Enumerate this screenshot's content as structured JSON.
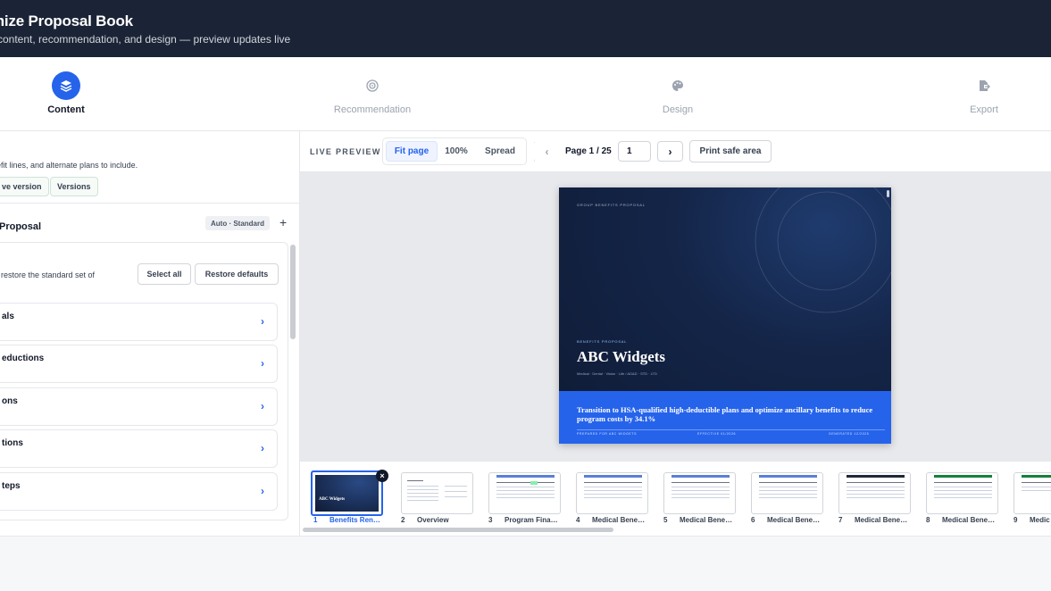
{
  "header": {
    "title": "mize Proposal Book",
    "subtitle": "content, recommendation, and design — preview updates live"
  },
  "stepper": {
    "steps": [
      {
        "label": "Content",
        "icon": "layers-icon",
        "active": true
      },
      {
        "label": "Recommendation",
        "icon": "target-icon",
        "active": false
      },
      {
        "label": "Design",
        "icon": "palette-icon",
        "active": false
      },
      {
        "label": "Export",
        "icon": "file-export-icon",
        "active": false
      }
    ]
  },
  "left_panel": {
    "description": "efit lines, and alternate plans to include.",
    "chip_version": "ve version",
    "chip_versions": "Versions",
    "section_title": "Proposal",
    "auto_badge": "Auto · Standard",
    "add": "+",
    "restore_text": "restore the standard set of",
    "select_all": "Select all",
    "restore_defaults": "Restore defaults",
    "sections": [
      {
        "label": "als"
      },
      {
        "label": "eductions"
      },
      {
        "label": "ons"
      },
      {
        "label": "tions"
      },
      {
        "label": "teps"
      }
    ],
    "chevron": "›"
  },
  "toolbar": {
    "live_preview": "LIVE PREVIEW",
    "fit_page": "Fit page",
    "zoom_100": "100%",
    "spread": "Spread",
    "prev": "‹",
    "next": "›",
    "page_label": "Page 1 / 25",
    "page_input": "1",
    "print_safe": "Print safe area"
  },
  "preview_page": {
    "kicker": "GROUP BENEFITS PROPOSAL",
    "eyebrow": "BENEFITS PROPOSAL",
    "company": "ABC Widgets",
    "lines": "Medical · Dental · Vision · Life / AD&D · STD · LTD",
    "recommendation": "Transition to HSA-qualified high-deductible plans and optimize ancillary benefits to reduce program costs by 34.1%",
    "footer_prepared": "PREPARED FOR ABC WIDGETS",
    "footer_effective": "EFFECTIVE 01/2026",
    "footer_generated": "GENERATED 12/2025"
  },
  "thumbnails": [
    {
      "num": "1",
      "label": "Benefits Ren…",
      "active": true,
      "cover_text": "ABC Widgets"
    },
    {
      "num": "2",
      "label": "Overview"
    },
    {
      "num": "3",
      "label": "Program Fina…"
    },
    {
      "num": "4",
      "label": "Medical Bene…"
    },
    {
      "num": "5",
      "label": "Medical Bene…"
    },
    {
      "num": "6",
      "label": "Medical Bene…"
    },
    {
      "num": "7",
      "label": "Medical Bene…"
    },
    {
      "num": "8",
      "label": "Medical Bene…"
    },
    {
      "num": "9",
      "label": "Medic"
    }
  ],
  "colors": {
    "accent": "#2563eb",
    "header_bg": "#1b2436",
    "cover_bg": "#142548"
  }
}
